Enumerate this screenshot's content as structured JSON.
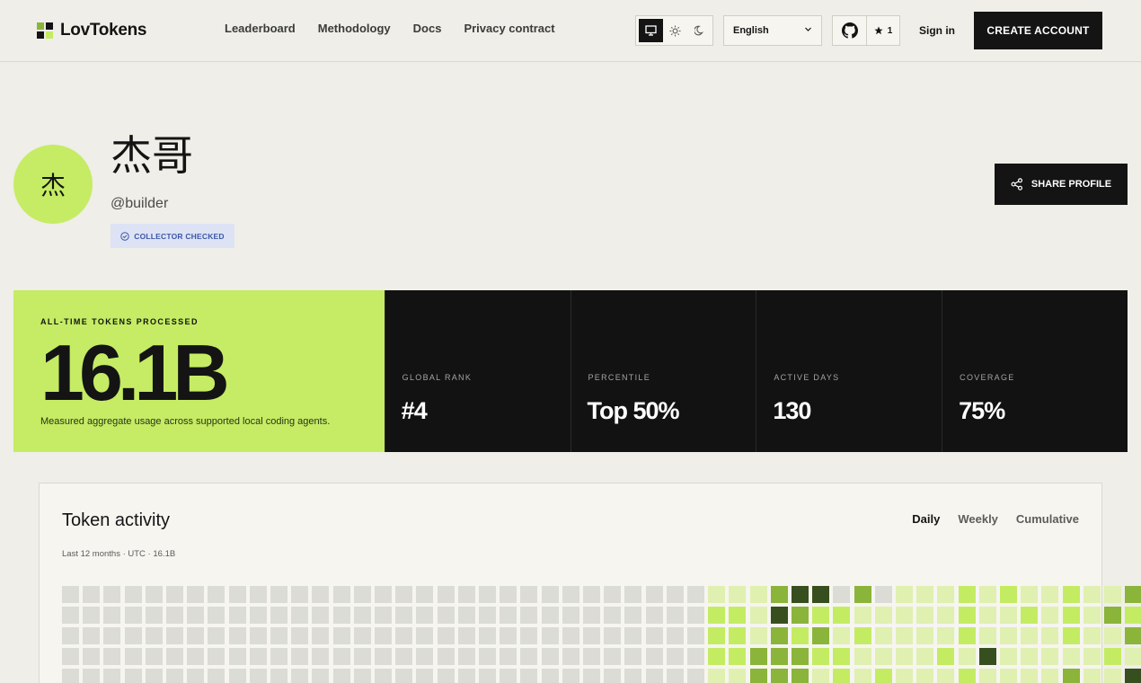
{
  "header": {
    "brand": "LovTokens",
    "nav": [
      "Leaderboard",
      "Methodology",
      "Docs",
      "Privacy contract"
    ],
    "theme_options": [
      "monitor-icon",
      "sun-icon",
      "moon-icon"
    ],
    "theme_selected": "monitor-icon",
    "language": "English",
    "github_stars": "1",
    "sign_in": "Sign in",
    "create_account": "CREATE ACCOUNT"
  },
  "profile": {
    "avatar_initial": "杰",
    "display_name": "杰哥",
    "handle": "@builder",
    "badge": "COLLECTOR CHECKED",
    "share": "SHARE PROFILE"
  },
  "stats": {
    "hero": {
      "label": "ALL-TIME TOKENS PROCESSED",
      "value": "16.1B",
      "description": "Measured aggregate usage across supported local coding agents."
    },
    "cells": [
      {
        "label": "GLOBAL RANK",
        "value": "#4"
      },
      {
        "label": "PERCENTILE",
        "value": "Top 50%"
      },
      {
        "label": "ACTIVE DAYS",
        "value": "130"
      },
      {
        "label": "COVERAGE",
        "value": "75%"
      }
    ]
  },
  "activity": {
    "title": "Token activity",
    "subtitle": "Last 12 months · UTC · 16.1B",
    "tabs": [
      "Daily",
      "Weekly",
      "Cumulative"
    ],
    "active_tab": "Daily",
    "levels_palette": [
      "#dcdcd7",
      "#e0f0b0",
      "#c4ec62",
      "#8bb43a",
      "#374f1e"
    ],
    "grid_rows": [
      "0000000000000000000000000000000111344030111212112113",
      "0000000000000000000000000000000221432211111211212132",
      "0000000000000000000000000000000221323121111211112113",
      "0000000000000000000000000000000223332211112141111121",
      "0000000000000000000000000000000113331212111211113114"
    ]
  },
  "colors": {
    "accent": "#c5ec64",
    "dark": "#121212",
    "page_bg": "#efeee8",
    "badge_bg": "#dde3f5",
    "badge_fg": "#3c57a6"
  }
}
